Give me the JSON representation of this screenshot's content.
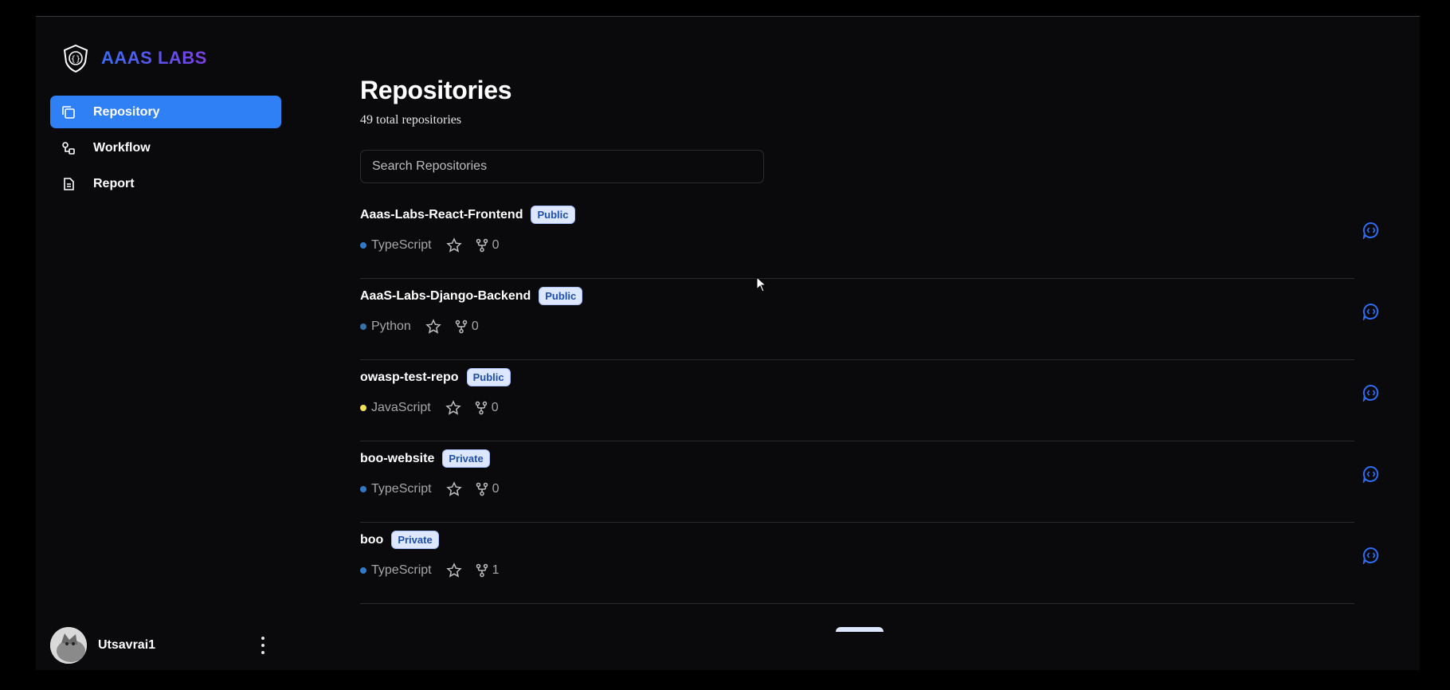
{
  "app": {
    "brand": "AAAS LABS",
    "brand_gradient": [
      "#3b6cf6",
      "#7b3fe4"
    ]
  },
  "sidebar": {
    "items": [
      {
        "label": "Repository",
        "icon": "copy-icon",
        "active": true
      },
      {
        "label": "Workflow",
        "icon": "workflow-icon",
        "active": false
      },
      {
        "label": "Report",
        "icon": "document-icon",
        "active": false
      }
    ],
    "user": {
      "name": "Utsavrai1",
      "avatar": "cat-avatar"
    }
  },
  "main": {
    "title": "Repositories",
    "subtitle": "49 total repositories",
    "search": {
      "placeholder": "Search Repositories",
      "value": ""
    },
    "repos": [
      {
        "name": "Aaas-Labs-React-Frontend",
        "visibility": "Public",
        "language": "TypeScript",
        "lang_color": "#3178c6",
        "forks": "0"
      },
      {
        "name": "AaaS-Labs-Django-Backend",
        "visibility": "Public",
        "language": "Python",
        "lang_color": "#3572a5",
        "forks": "0"
      },
      {
        "name": "owasp-test-repo",
        "visibility": "Public",
        "language": "JavaScript",
        "lang_color": "#f1e05a",
        "forks": "0"
      },
      {
        "name": "boo-website",
        "visibility": "Private",
        "language": "TypeScript",
        "lang_color": "#3178c6",
        "forks": "0"
      },
      {
        "name": "boo",
        "visibility": "Private",
        "language": "TypeScript",
        "lang_color": "#3178c6",
        "forks": "1"
      }
    ]
  },
  "colors": {
    "accent": "#2f80f5",
    "badge_bg": "#dde7ff",
    "badge_text": "#1f4fa8",
    "chat_icon": "#2f6cf0"
  }
}
